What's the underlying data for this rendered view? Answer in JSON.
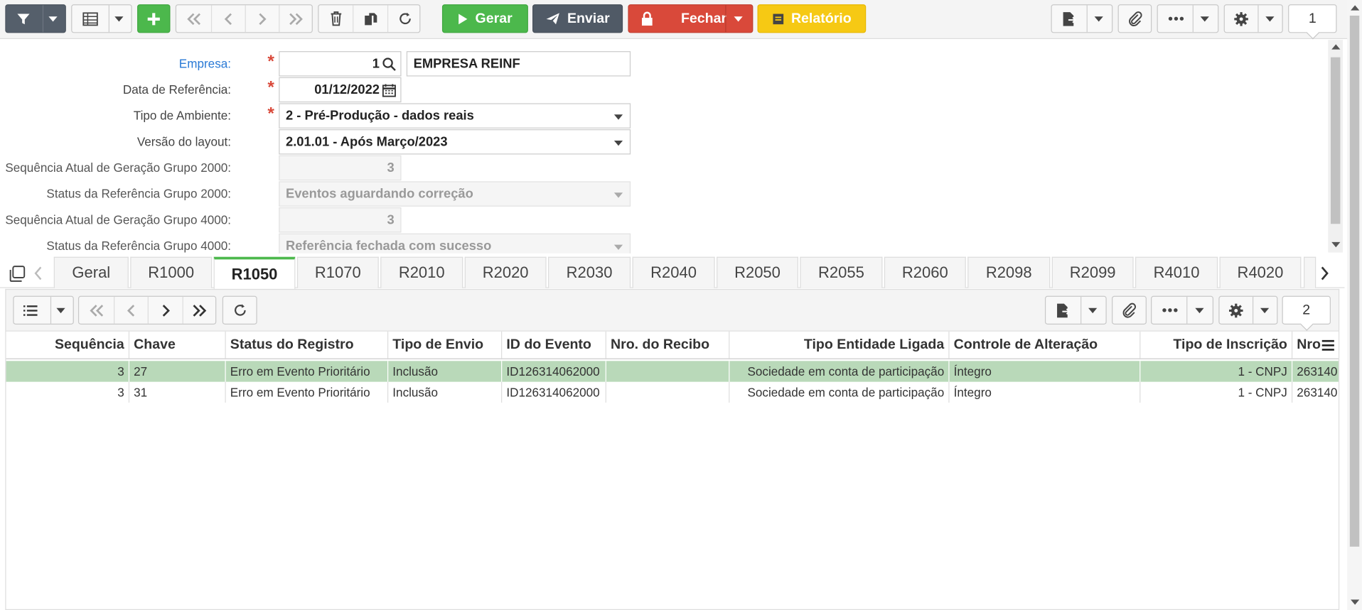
{
  "toolbar": {
    "gerar": "Gerar",
    "enviar": "Enviar",
    "fechar": "Fechar",
    "relatorio": "Relatório",
    "page": "1"
  },
  "form": {
    "empresa_label": "Empresa:",
    "empresa_code": "1",
    "empresa_name": "EMPRESA REINF",
    "data_label": "Data de Referência:",
    "data_value": "01/12/2022",
    "ambiente_label": "Tipo de Ambiente:",
    "ambiente_value": "2 - Pré-Produção - dados reais",
    "versao_label": "Versão do layout:",
    "versao_value": "2.01.01 - Após Março/2023",
    "seq2000_label": "Sequência Atual de Geração Grupo 2000:",
    "seq2000_value": "3",
    "status2000_label": "Status da Referência Grupo 2000:",
    "status2000_value": "Eventos aguardando correção",
    "seq4000_label": "Sequência Atual de Geração Grupo 4000:",
    "seq4000_value": "3",
    "status4000_label": "Status da Referência Grupo 4000:",
    "status4000_value": "Referência fechada com sucesso"
  },
  "tabs": [
    "Geral",
    "R1000",
    "R1050",
    "R1070",
    "R2010",
    "R2020",
    "R2030",
    "R2040",
    "R2050",
    "R2055",
    "R2060",
    "R2098",
    "R2099",
    "R4010",
    "R4020"
  ],
  "active_tab": "R1050",
  "subbar": {
    "page": "2"
  },
  "grid": {
    "columns": [
      "Sequência",
      "Chave",
      "Status do Registro",
      "Tipo de Envio",
      "ID do Evento",
      "Nro. do Recibo",
      "Tipo Entidade Ligada",
      "Controle de Alteração",
      "Tipo de Inscrição",
      "Nro"
    ],
    "rows": [
      [
        "3",
        "27",
        "Erro em Evento Prioritário",
        "Inclusão",
        "ID126314062000",
        "",
        "Sociedade em conta de participação",
        "Íntegro",
        "1 - CNPJ",
        "263140"
      ],
      [
        "3",
        "31",
        "Erro em Evento Prioritário",
        "Inclusão",
        "ID126314062000",
        "",
        "Sociedade em conta de participação",
        "Íntegro",
        "1 - CNPJ",
        "263140"
      ]
    ]
  }
}
